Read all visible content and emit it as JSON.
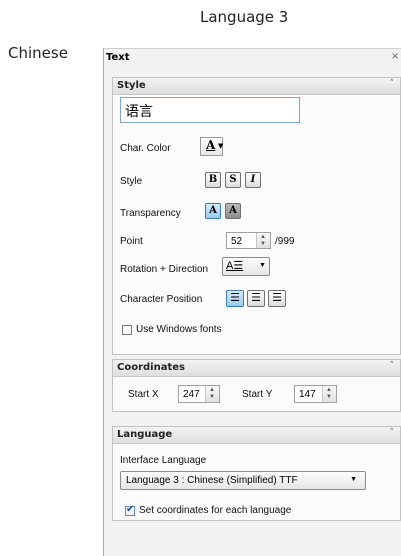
{
  "heading": "Language 3",
  "side_label": "Chinese",
  "panel": {
    "title": "Text",
    "close": "×"
  },
  "style": {
    "title": "Style",
    "collapse": "˄",
    "text_value": "语言",
    "char_color_label": "Char. Color",
    "char_color_glyph": "A",
    "style_label": "Style",
    "style_buttons": [
      "B",
      "S",
      "I"
    ],
    "transparency_label": "Transparency",
    "transparency_buttons": [
      "A",
      "A"
    ],
    "point_label": "Point",
    "point_value": "52",
    "point_max": "/999",
    "rotation_label": "Rotation + Direction",
    "char_position_label": "Character Position",
    "windows_fonts_label": "Use Windows fonts"
  },
  "coordinates": {
    "title": "Coordinates",
    "collapse": "˄",
    "start_x_label": "Start X",
    "start_x_value": "247",
    "start_y_label": "Start Y",
    "start_y_value": "147"
  },
  "language": {
    "title": "Language",
    "collapse": "˄",
    "interface_label": "Interface Language",
    "selected": "Language 3 : Chinese (Simplified) TTF",
    "set_coords_label": "Set coordinates for each language",
    "set_coords_checked": true
  }
}
